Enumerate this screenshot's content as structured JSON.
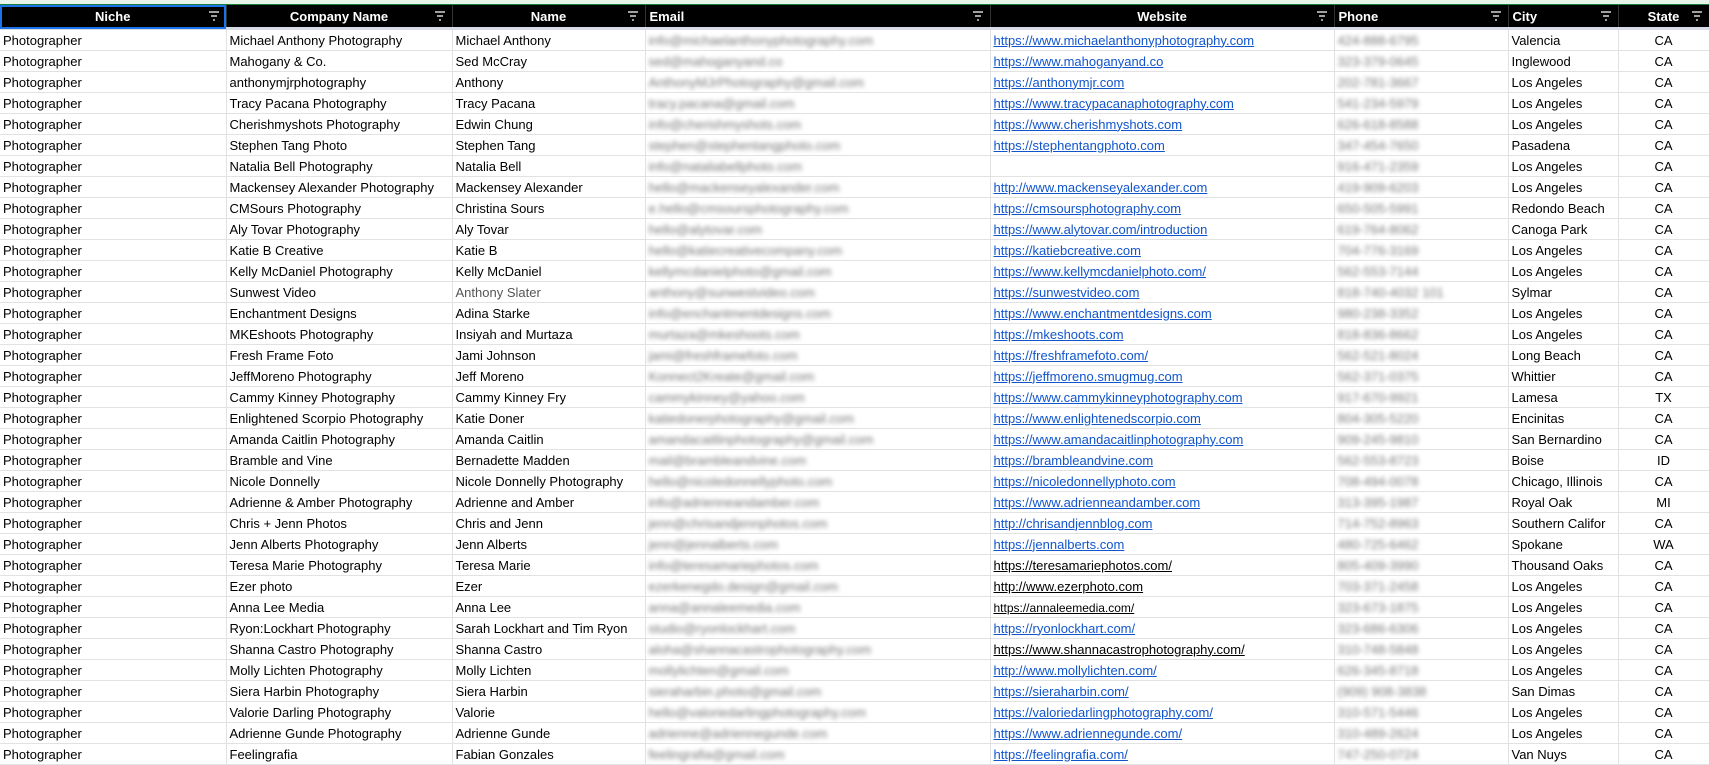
{
  "headers": [
    "Niche",
    "Company Name",
    "Name",
    "Email",
    "Website",
    "Phone",
    "City",
    "State"
  ],
  "rows": [
    [
      "Photographer",
      "Michael Anthony Photography",
      "Michael Anthony",
      "info@michaelanthonyphotography.com",
      "https://www.michaelanthonyphotography.com",
      "424-888-6795",
      "Valencia",
      "CA"
    ],
    [
      "Photographer",
      "Mahogany & Co.",
      "Sed McCray",
      "sed@mahoganyand.co",
      "https://www.mahoganyand.co",
      "323-379-0645",
      "Inglewood",
      "CA"
    ],
    [
      "Photographer",
      "anthonymjrphotography",
      "Anthony",
      "AnthonyMJrPhotography@gmail.com",
      "https://anthonymjr.com",
      "202-781-3667",
      "Los Angeles",
      "CA"
    ],
    [
      "Photographer",
      "Tracy Pacana Photography",
      "Tracy Pacana",
      "tracy.pacana@gmail.com",
      "https://www.tracypacanaphotography.com",
      "541-234-5979",
      "Los Angeles",
      "CA"
    ],
    [
      "Photographer",
      "Cherishmyshots Photography",
      "Edwin Chung",
      "info@cherishmyshots.com",
      "https://www.cherishmyshots.com",
      "626-618-8588",
      "Los Angeles",
      "CA"
    ],
    [
      "Photographer",
      "Stephen Tang Photo",
      "Stephen Tang",
      "stephen@stephentangphoto.com",
      "https://stephentangphoto.com",
      "347-454-7650",
      "Pasadena",
      "CA"
    ],
    [
      "Photographer",
      "Natalia Bell Photography",
      "Natalia Bell",
      "info@nataliabellphoto.com",
      "",
      "916-471-2359",
      "Los Angeles",
      "CA"
    ],
    [
      "Photographer",
      "Mackensey Alexander Photography",
      "Mackensey Alexander",
      "hello@mackenseyalexander.com",
      "http://www.mackenseyalexander.com",
      "419-909-6203",
      "Los Angeles",
      "CA"
    ],
    [
      "Photographer",
      "CMSours Photography",
      "Christina Sours",
      "e.hello@cmsoursphotography.com",
      "https://cmsoursphotography.com",
      "650-505-5991",
      "Redondo Beach",
      "CA"
    ],
    [
      "Photographer",
      "Aly Tovar Photography",
      "Aly Tovar",
      "hello@alytovar.com",
      "https://www.alytovar.com/introduction",
      "619-764-8062",
      "Canoga Park",
      "CA"
    ],
    [
      "Photographer",
      "Katie B Creative",
      "Katie B",
      "hello@katiecreativecompany.com",
      "https://katiebcreative.com",
      "704-776-3169",
      "Los Angeles",
      "CA"
    ],
    [
      "Photographer",
      "Kelly McDaniel Photography",
      "Kelly McDaniel",
      "kellymcdanielphoto@gmail.com",
      "https://www.kellymcdanielphoto.com/",
      "562-553-7144",
      "Los Angeles",
      "CA"
    ],
    [
      "Photographer",
      "Sunwest Video",
      "Anthony Slater",
      "anthony@sunwestvideo.com",
      "https://sunwestvideo.com",
      "818-740-4032 101",
      "Sylmar",
      "CA"
    ],
    [
      "Photographer",
      "Enchantment Designs",
      "Adina Starke",
      "info@enchantmentdesigns.com",
      "https://www.enchantmentdesigns.com",
      "980-238-3352",
      "Los Angeles",
      "CA"
    ],
    [
      "Photographer",
      "MKEshoots Photography",
      "Insiyah and Murtaza",
      "murtaza@mkeshoots.com",
      "https://mkeshoots.com",
      "818-836-8662",
      "Los Angeles",
      "CA"
    ],
    [
      "Photographer",
      "Fresh Frame Foto",
      "Jami Johnson",
      "jami@freshframefoto.com",
      "https://freshframefoto.com/",
      "562-521-8024",
      "Long Beach",
      "CA"
    ],
    [
      "Photographer",
      "JeffMoreno Photography",
      "Jeff Moreno",
      "Konnect2Kreate@gmail.com",
      "https://jeffmoreno.smugmug.com",
      "562-371-0375",
      "Whittier",
      "CA"
    ],
    [
      "Photographer",
      "Cammy Kinney Photography",
      "Cammy Kinney Fry",
      "cammykinney@yahoo.com",
      "https://www.cammykinneyphotography.com",
      "917-670-9921",
      "Lamesa",
      "TX"
    ],
    [
      "Photographer",
      "Enlightened Scorpio Photography",
      "Katie Doner",
      "katiedonerphotography@gmail.com",
      "https://www.enlightenedscorpio.com",
      "804-305-5220",
      "Encinitas",
      "CA"
    ],
    [
      "Photographer",
      "Amanda Caitlin Photography",
      "Amanda Caitlin",
      "amandacaitlinphotography@gmail.com",
      "https://www.amandacaitlinphotography.com",
      "909-245-9810",
      "San Bernardino",
      "CA"
    ],
    [
      "Photographer",
      "Bramble and Vine",
      "Bernadette Madden",
      "mail@brambleandvine.com",
      "https://brambleandvine.com",
      "562-553-8723",
      "Boise",
      "ID"
    ],
    [
      "Photographer",
      "Nicole Donnelly",
      "Nicole Donnelly Photography",
      "hello@nicoledonnellyphoto.com",
      "https://nicoledonnellyphoto.com",
      "708-494-0078",
      "Chicago, Illinois",
      "CA"
    ],
    [
      "Photographer",
      "Adrienne & Amber Photography",
      "Adrienne and Amber",
      "info@adrienneandamber.com",
      "https://www.adrienneandamber.com",
      "313-395-1987",
      "Royal Oak",
      "MI"
    ],
    [
      "Photographer",
      "Chris + Jenn Photos",
      "Chris and Jenn",
      "jenn@chrisandjennphotos.com",
      "http://chrisandjennblog.com",
      "714-752-8963",
      "Southern Califor",
      "CA"
    ],
    [
      "Photographer",
      "Jenn Alberts Photography",
      "Jenn Alberts",
      "jenn@jennalberts.com",
      "https://jennalberts.com",
      "480-725-6462",
      "Spokane",
      "WA"
    ],
    [
      "Photographer",
      "Teresa Marie Photography",
      "Teresa Marie",
      "info@teresamariephotos.com",
      "https://teresamariephotos.com/",
      "805-409-3990",
      "Thousand Oaks",
      "CA"
    ],
    [
      "Photographer",
      "Ezer photo",
      "Ezer",
      "ezerkenegdo.design@gmail.com",
      "http://www.ezerphoto.com",
      "703-371-2458",
      "Los Angeles",
      "CA"
    ],
    [
      "Photographer",
      "Anna Lee Media",
      "Anna Lee",
      "anna@annaleemedia.com",
      "https://annaleemedia.com/",
      "323-673-1875",
      "Los Angeles",
      "CA"
    ],
    [
      "Photographer",
      "Ryon:Lockhart Photography",
      "Sarah Lockhart and Tim Ryon",
      "studio@ryonlockhart.com",
      "https://ryonlockhart.com/",
      "323-686-6306",
      "Los Angeles",
      "CA"
    ],
    [
      "Photographer",
      "Shanna Castro Photography",
      "Shanna Castro",
      "aloha@shannacastrophotography.com",
      "https://www.shannacastrophotography.com/",
      "310-748-5848",
      "Los Angeles",
      "CA"
    ],
    [
      "Photographer",
      "Molly Lichten Photography",
      "Molly Lichten",
      "mollylichten@gmail.com",
      "http://www.mollylichten.com/",
      "626-345-8718",
      "Los Angeles",
      "CA"
    ],
    [
      "Photographer",
      "Siera Harbin Photography",
      "Siera Harbin",
      "sieraharbin.photo@gmail.com",
      "https://sieraharbin.com/",
      "(909) 908-3838",
      "San Dimas",
      "CA"
    ],
    [
      "Photographer",
      "Valorie Darling Photography",
      "Valorie",
      "hello@valoriedarlingphotography.com",
      "https://valoriedarlingphotography.com/",
      "310-571-5446",
      "Los Angeles",
      "CA"
    ],
    [
      "Photographer",
      "Adrienne Gunde Photography",
      "Adrienne Gunde",
      "adrienne@adriennegunde.com",
      "https://www.adriennegunde.com/",
      "310-489-2624",
      "Los Angeles",
      "CA"
    ],
    [
      "Photographer",
      "Feelingrafia",
      "Fabian Gonzales",
      "feelingrafia@gmail.com",
      "https://feelingrafia.com/",
      "747-250-0724",
      "Van Nuys",
      "CA"
    ]
  ],
  "colors": {
    "header_bg": "#000000",
    "link": "#1155cc",
    "selection": "#1a73e8"
  },
  "icons": {
    "filter": "filter-icon"
  }
}
